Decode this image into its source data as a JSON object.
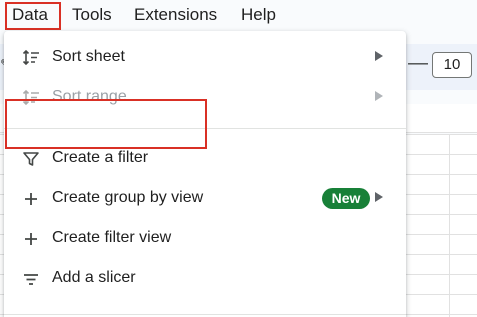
{
  "menubar": {
    "items": [
      "Data",
      "Tools",
      "Extensions",
      "Help"
    ]
  },
  "toolbar": {
    "font_size_value": "10"
  },
  "data_menu": {
    "items": [
      {
        "label": "Sort sheet",
        "icon": "sort-icon",
        "submenu": true,
        "enabled": true
      },
      {
        "label": "Sort range",
        "icon": "sort-icon",
        "submenu": true,
        "enabled": false
      },
      {
        "label": "Create a filter",
        "icon": "filter-icon",
        "submenu": false,
        "enabled": true
      },
      {
        "label": "Create group by view",
        "icon": "plus-icon",
        "submenu": true,
        "enabled": true,
        "badge": "New"
      },
      {
        "label": "Create filter view",
        "icon": "plus-icon",
        "submenu": false,
        "enabled": true
      },
      {
        "label": "Add a slicer",
        "icon": "slicer-icon",
        "submenu": false,
        "enabled": true
      }
    ]
  },
  "colors": {
    "highlight": "#d93025",
    "badge": "#188038",
    "disabled_text": "#9aa0a6"
  }
}
